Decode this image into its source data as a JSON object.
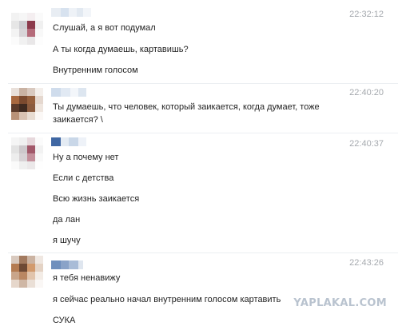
{
  "conversation": {
    "groups": [
      {
        "time": "22:32:12",
        "lines": [
          "Слушай, а я вот подумал",
          "А ты когда думаешь, картавишь?",
          "Внутренним голосом"
        ]
      },
      {
        "time": "22:40:20",
        "lines": [
          "Ты думаешь, что человек, который заикается, когда думает, тоже",
          "заикается? \\"
        ]
      },
      {
        "time": "22:40:37",
        "lines": [
          "Ну а почему нет",
          "Если с детства",
          "Всю жизнь заикается",
          "да лан",
          "я шучу"
        ]
      },
      {
        "time": "22:43:26",
        "lines": [
          "я тебя ненавижу",
          "я сейчас реально начал внутренним голосом картавить",
          "СУКА"
        ]
      }
    ]
  },
  "watermark": "YAPLAKAL.COM",
  "colors": {
    "time": "#a5a9ae",
    "text": "#1f1f1f",
    "watermark": "#b9c3cf"
  }
}
